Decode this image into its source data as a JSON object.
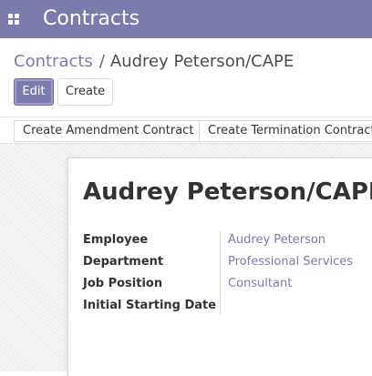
{
  "navbar": {
    "app_title": "Contracts",
    "apps_icon": "grid-icon",
    "color": "#7c7bad"
  },
  "breadcrumb": {
    "parent": "Contracts",
    "separator": "/",
    "current": "Audrey Peterson/CAPE"
  },
  "buttons": {
    "edit": "Edit",
    "create": "Create"
  },
  "statusbar": {
    "amendment": "Create Amendment Contract",
    "termination": "Create Termination Contract"
  },
  "record": {
    "title": "Audrey Peterson/CAPE",
    "fields": [
      {
        "label": "Employee",
        "value": "Audrey Peterson"
      },
      {
        "label": "Department",
        "value": "Professional Services"
      },
      {
        "label": "Job Position",
        "value": "Consultant"
      },
      {
        "label": "Initial Starting Date",
        "value": ""
      }
    ]
  },
  "colors": {
    "accent": "#7c7bad",
    "text": "#333333"
  }
}
